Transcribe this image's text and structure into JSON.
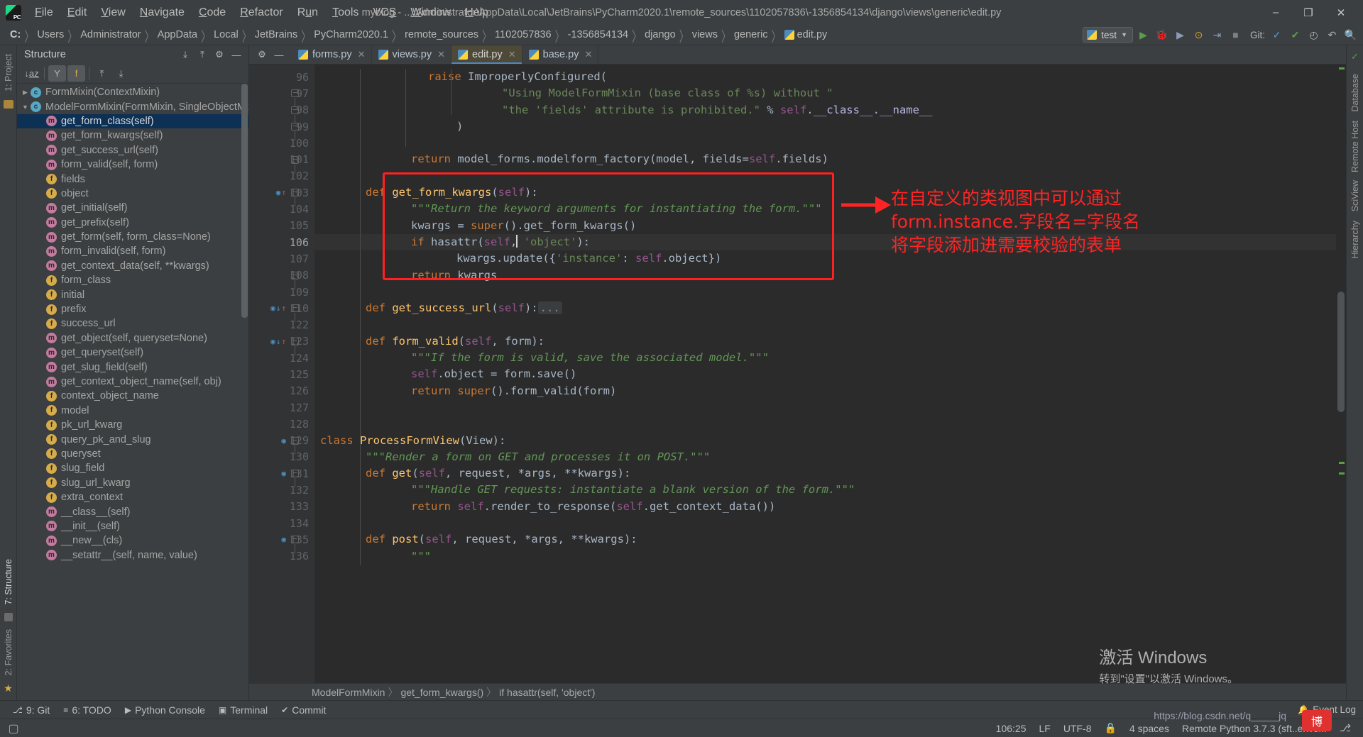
{
  "window": {
    "title": "myblog - ...\\Administrator\\AppData\\Local\\JetBrains\\PyCharm2020.1\\remote_sources\\1102057836\\-1356854134\\django\\views\\generic\\edit.py",
    "minimize": "–",
    "maximize": "❐",
    "close": "✕"
  },
  "menu": [
    {
      "label": "File"
    },
    {
      "label": "Edit"
    },
    {
      "label": "View"
    },
    {
      "label": "Navigate"
    },
    {
      "label": "Code"
    },
    {
      "label": "Refactor"
    },
    {
      "label": "Run"
    },
    {
      "label": "Tools"
    },
    {
      "label": "VCS"
    },
    {
      "label": "Window"
    },
    {
      "label": "Help"
    }
  ],
  "breadcrumb": [
    "C:",
    "Users",
    "Administrator",
    "AppData",
    "Local",
    "JetBrains",
    "PyCharm2020.1",
    "remote_sources",
    "1102057836",
    "-1356854134",
    "django",
    "views",
    "generic",
    "edit.py"
  ],
  "toolbar": {
    "run_config": "test",
    "run_icon": "▶",
    "debug_icon": "🐞",
    "coverage_icon": "▶",
    "profile_icon": "⊙",
    "attach_icon": "⇥",
    "stop_icon": "■",
    "git_label": "Git:",
    "git_update_icon": "✓",
    "git_commit_icon": "✔",
    "git_history_icon": "◴",
    "git_revert_icon": "↶",
    "search_icon": "🔍"
  },
  "left_strip": [
    {
      "label": "1: Project"
    },
    {
      "label": "7: Structure"
    },
    {
      "label": "2: Favorites"
    }
  ],
  "right_strip": [
    {
      "label": "Database"
    },
    {
      "label": "Remote Host"
    },
    {
      "label": "SciView"
    },
    {
      "label": "Hierarchy"
    }
  ],
  "structure": {
    "title": "Structure",
    "header_icons": [
      {
        "name": "expand-all-icon",
        "glyph": "⤓"
      },
      {
        "name": "collapse-all-icon",
        "glyph": "⤒"
      }
    ],
    "toolbar": [
      {
        "name": "sort-alphabetically-button",
        "glyph": "↓a̲z̲",
        "active": false
      },
      {
        "name": "show-inherited-button",
        "glyph": "Υ",
        "active": true
      },
      {
        "name": "show-fields-button",
        "glyph": "f",
        "active": true
      },
      {
        "name": "scroll-from-source-button",
        "glyph": "⤒",
        "active": false
      },
      {
        "name": "scroll-to-source-button",
        "glyph": "⤓",
        "active": false
      }
    ],
    "tree": [
      {
        "label": "FormMixin(ContextMixin)",
        "kind": "c",
        "depth": 0,
        "arrow": "collapsed",
        "selected": false
      },
      {
        "label": "ModelFormMixin(FormMixin, SingleObjectMixin)",
        "kind": "c",
        "depth": 0,
        "arrow": "expanded",
        "selected": false
      },
      {
        "label": "get_form_class(self)",
        "kind": "m",
        "depth": 1,
        "arrow": "none",
        "selected": true
      },
      {
        "label": "get_form_kwargs(self)",
        "kind": "m",
        "depth": 1,
        "arrow": "none",
        "selected": false
      },
      {
        "label": "get_success_url(self)",
        "kind": "m",
        "depth": 1,
        "arrow": "none",
        "selected": false
      },
      {
        "label": "form_valid(self, form)",
        "kind": "m",
        "depth": 1,
        "arrow": "none",
        "selected": false
      },
      {
        "label": "fields",
        "kind": "f",
        "depth": 1,
        "arrow": "none",
        "selected": false
      },
      {
        "label": "object",
        "kind": "f",
        "depth": 1,
        "arrow": "none",
        "selected": false
      },
      {
        "label": "get_initial(self)",
        "kind": "m",
        "depth": 1,
        "arrow": "none",
        "selected": false
      },
      {
        "label": "get_prefix(self)",
        "kind": "m",
        "depth": 1,
        "arrow": "none",
        "selected": false
      },
      {
        "label": "get_form(self, form_class=None)",
        "kind": "m",
        "depth": 1,
        "arrow": "none",
        "selected": false
      },
      {
        "label": "form_invalid(self, form)",
        "kind": "m",
        "depth": 1,
        "arrow": "none",
        "selected": false
      },
      {
        "label": "get_context_data(self, **kwargs)",
        "kind": "m",
        "depth": 1,
        "arrow": "none",
        "selected": false
      },
      {
        "label": "form_class",
        "kind": "f",
        "depth": 1,
        "arrow": "none",
        "selected": false
      },
      {
        "label": "initial",
        "kind": "f",
        "depth": 1,
        "arrow": "none",
        "selected": false
      },
      {
        "label": "prefix",
        "kind": "f",
        "depth": 1,
        "arrow": "none",
        "selected": false
      },
      {
        "label": "success_url",
        "kind": "f",
        "depth": 1,
        "arrow": "none",
        "selected": false
      },
      {
        "label": "get_object(self, queryset=None)",
        "kind": "m",
        "depth": 1,
        "arrow": "none",
        "selected": false
      },
      {
        "label": "get_queryset(self)",
        "kind": "m",
        "depth": 1,
        "arrow": "none",
        "selected": false
      },
      {
        "label": "get_slug_field(self)",
        "kind": "m",
        "depth": 1,
        "arrow": "none",
        "selected": false
      },
      {
        "label": "get_context_object_name(self, obj)",
        "kind": "m",
        "depth": 1,
        "arrow": "none",
        "selected": false
      },
      {
        "label": "context_object_name",
        "kind": "f",
        "depth": 1,
        "arrow": "none",
        "selected": false
      },
      {
        "label": "model",
        "kind": "f",
        "depth": 1,
        "arrow": "none",
        "selected": false
      },
      {
        "label": "pk_url_kwarg",
        "kind": "f",
        "depth": 1,
        "arrow": "none",
        "selected": false
      },
      {
        "label": "query_pk_and_slug",
        "kind": "f",
        "depth": 1,
        "arrow": "none",
        "selected": false
      },
      {
        "label": "queryset",
        "kind": "f",
        "depth": 1,
        "arrow": "none",
        "selected": false
      },
      {
        "label": "slug_field",
        "kind": "f",
        "depth": 1,
        "arrow": "none",
        "selected": false
      },
      {
        "label": "slug_url_kwarg",
        "kind": "f",
        "depth": 1,
        "arrow": "none",
        "selected": false
      },
      {
        "label": "extra_context",
        "kind": "f",
        "depth": 1,
        "arrow": "none",
        "selected": false
      },
      {
        "label": "__class__(self)",
        "kind": "m",
        "depth": 1,
        "arrow": "none",
        "selected": false
      },
      {
        "label": "__init__(self)",
        "kind": "m",
        "depth": 1,
        "arrow": "none",
        "selected": false
      },
      {
        "label": "__new__(cls)",
        "kind": "m",
        "depth": 1,
        "arrow": "none",
        "selected": false
      },
      {
        "label": "__setattr__(self, name, value)",
        "kind": "m",
        "depth": 1,
        "arrow": "none",
        "selected": false
      }
    ]
  },
  "tabs": [
    {
      "label": "forms.py",
      "active": false
    },
    {
      "label": "views.py",
      "active": false
    },
    {
      "label": "edit.py",
      "active": true
    },
    {
      "label": "base.py",
      "active": false
    }
  ],
  "editor": {
    "first_line": 96,
    "current_line": 106,
    "lines": [
      {
        "n": 96,
        "fold": false
      },
      {
        "n": 97,
        "fold": true
      },
      {
        "n": 98,
        "fold": true
      },
      {
        "n": 99,
        "fold": true
      },
      {
        "n": 100,
        "fold": false
      },
      {
        "n": 101,
        "fold": true
      },
      {
        "n": 102,
        "fold": false
      },
      {
        "n": 103,
        "fold": true,
        "gmark": "override"
      },
      {
        "n": 104,
        "fold": false
      },
      {
        "n": 105,
        "fold": false
      },
      {
        "n": 106,
        "fold": false,
        "current": true
      },
      {
        "n": 107,
        "fold": false
      },
      {
        "n": 108,
        "fold": true
      },
      {
        "n": 109,
        "fold": false
      },
      {
        "n": 110,
        "fold": true,
        "gmark": "override2"
      },
      {
        "n": 122,
        "fold": false
      },
      {
        "n": 123,
        "fold": true,
        "gmark": "override2"
      },
      {
        "n": 124,
        "fold": false
      },
      {
        "n": 125,
        "fold": false
      },
      {
        "n": 126,
        "fold": false
      },
      {
        "n": 127,
        "fold": false
      },
      {
        "n": 128,
        "fold": false
      },
      {
        "n": 129,
        "fold": true,
        "gmark": "impl"
      },
      {
        "n": 130,
        "fold": false
      },
      {
        "n": 131,
        "fold": true,
        "gmark": "impl"
      },
      {
        "n": 132,
        "fold": false
      },
      {
        "n": 133,
        "fold": false
      },
      {
        "n": 134,
        "fold": false
      },
      {
        "n": 135,
        "fold": true,
        "gmark": "impl"
      },
      {
        "n": 136,
        "fold": false
      }
    ],
    "breadcrumb": [
      "ModelFormMixin",
      "get_form_kwargs()",
      "if hasattr(self, 'object')"
    ]
  },
  "annotation": {
    "line1": "在自定义的类视图中可以通过",
    "line2": "form.instance.字段名=字段名",
    "line3": "将字段添加进需要校验的表单",
    "color": "#ff2424"
  },
  "bottom_toolbar": [
    {
      "label": "9: Git",
      "icon": "⎇"
    },
    {
      "label": "6: TODO",
      "icon": "≡"
    },
    {
      "label": "Python Console",
      "icon": "▶"
    },
    {
      "label": "Terminal",
      "icon": "▣"
    },
    {
      "label": "Commit",
      "icon": "✔"
    }
  ],
  "event_log": {
    "label": "Event Log",
    "icon": "🔔"
  },
  "statusbar": {
    "caret": "106:25",
    "line_sep": "LF",
    "encoding": "UTF-8",
    "lock_icon": "🔒",
    "indent": "4 spaces",
    "interpreter": "Remote Python 3.7.3 (sft..envs...",
    "branch_icon": "⎇"
  },
  "watermark": {
    "line1": "激活 Windows",
    "line2": "转到\"设置\"以激活 Windows。"
  },
  "url_watermark": "https://blog.csdn.net/q_____jq"
}
